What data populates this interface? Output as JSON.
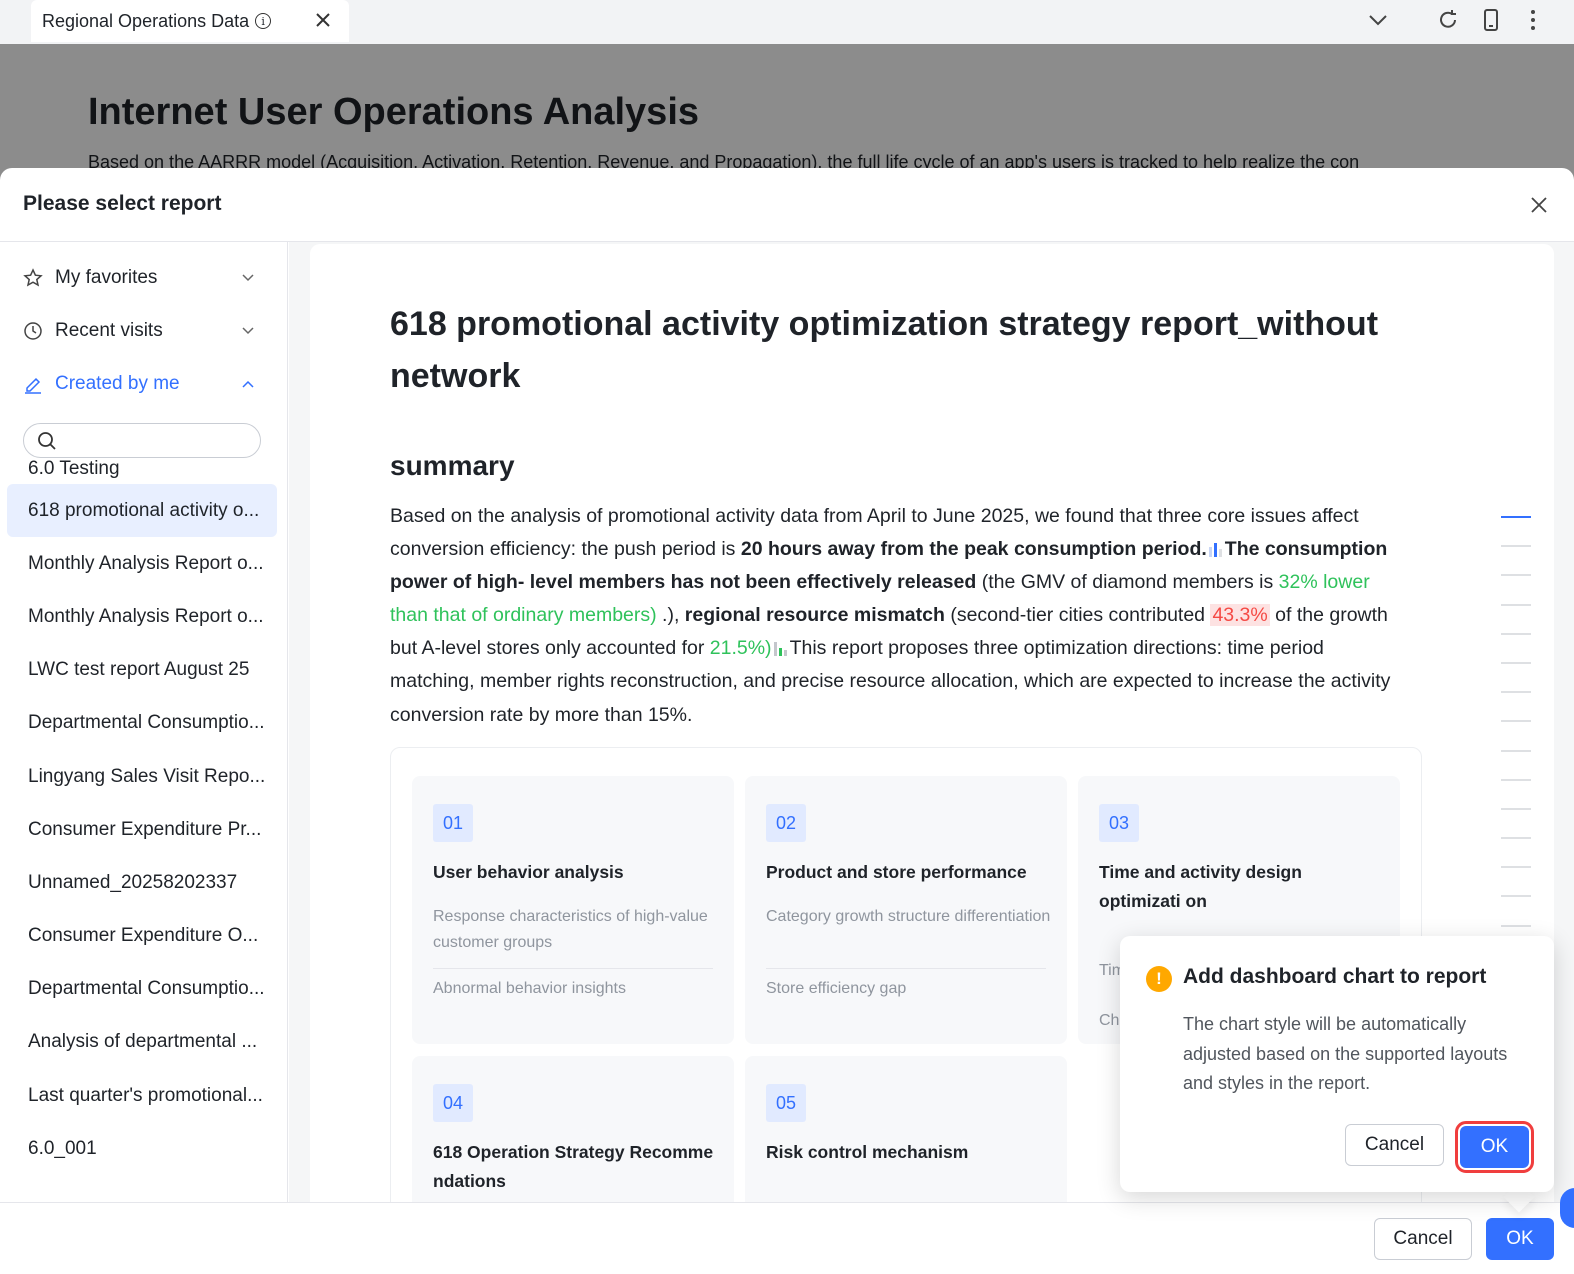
{
  "tab": {
    "title": "Regional Operations Data"
  },
  "background_page": {
    "title": "Internet User Operations Analysis",
    "subtitle": "Based on the AARRR model (Acquisition, Activation, Retention, Revenue, and Propagation), the full life cycle of an app's users is tracked to help realize the con"
  },
  "modal": {
    "title": "Please select report",
    "nav": {
      "favorites": "My favorites",
      "recent": "Recent visits",
      "created": "Created by me"
    },
    "search": {
      "placeholder": ""
    },
    "reports": [
      "6.0 Testing",
      "618 promotional activity o...",
      "Monthly Analysis Report o...",
      "Monthly Analysis Report o...",
      "LWC test report August 25",
      "Departmental Consumptio...",
      "Lingyang Sales Visit Repo...",
      "Consumer Expenditure Pr...",
      "Unnamed_20258202337",
      "Consumer Expenditure O...",
      "Departmental Consumptio...",
      "Analysis of departmental ...",
      "Last quarter's promotional...",
      "6.0_001"
    ],
    "selected_index": 1,
    "footer": {
      "cancel": "Cancel",
      "ok": "OK"
    }
  },
  "preview": {
    "title": "618 promotional activity optimization strategy report_without network",
    "section": "summary",
    "para": {
      "p1": "Based on the analysis of promotional activity data from April to June 2025, we found that three core issues affect conversion efficiency: the push period is ",
      "b1": "20 hours away from the peak consumption period.",
      "b2": "The consumption power of high- level members has not been effectively released",
      "p2": " (the GMV of diamond members is ",
      "g1": "32% lower than that of ordinary members)",
      "p3": " .), ",
      "b3": "regional resource mismatch",
      "p4": " (second-tier cities contributed ",
      "r1": "43.3%",
      "p5": " of the growth but A-level stores only accounted for ",
      "g2": "21.5%)",
      "p6": "This report proposes three optimization directions: time period matching, member rights reconstruction, and precise resource allocation, which are expected to increase the activity conversion rate by more than 15%."
    },
    "cards": [
      {
        "num": "01",
        "title": "User behavior analysis",
        "desc": "Response characteristics of high-value customer groups",
        "desc2": "Abnormal behavior insights"
      },
      {
        "num": "02",
        "title": "Product and store performance",
        "desc": "Category growth structure differentiation",
        "desc2": "Store efficiency gap"
      },
      {
        "num": "03",
        "title": "Time and activity design optimizati on",
        "desc": "Tim",
        "desc2": "Ch"
      },
      {
        "num": "04",
        "title": "618 Operation Strategy Recomme ndations"
      },
      {
        "num": "05",
        "title": "Risk control mechanism"
      }
    ]
  },
  "popconfirm": {
    "icon": "warning-icon",
    "title": "Add dashboard chart to report",
    "body": "The chart style will be automatically adjusted based on the supported layouts and styles in the report.",
    "cancel": "Cancel",
    "ok": "OK"
  },
  "colors": {
    "accent": "#3370ff",
    "warning": "#ffa800",
    "positive": "#2fc25b",
    "negative": "#f54a45"
  }
}
